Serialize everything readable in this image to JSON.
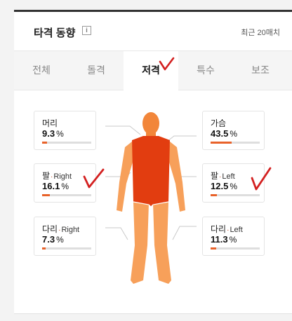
{
  "header": {
    "title": "타격 동향",
    "info_icon": "i",
    "recent_label": "최근 20매치"
  },
  "tabs": [
    {
      "label": "전체",
      "active": false
    },
    {
      "label": "돌격",
      "active": false
    },
    {
      "label": "저격",
      "active": true
    },
    {
      "label": "특수",
      "active": false
    },
    {
      "label": "보조",
      "active": false
    }
  ],
  "stats": {
    "head": {
      "label": "머리",
      "value": "9.3",
      "unit": "%",
      "fraction": 0.093
    },
    "chest": {
      "label": "가슴",
      "value": "43.5",
      "unit": "%",
      "fraction": 0.435
    },
    "arm_right": {
      "label": "팔",
      "side": "Right",
      "value": "16.1",
      "unit": "%",
      "fraction": 0.161
    },
    "arm_left": {
      "label": "팔",
      "side": "Left",
      "value": "12.5",
      "unit": "%",
      "fraction": 0.125
    },
    "leg_right": {
      "label": "다리",
      "side": "Right",
      "value": "7.3",
      "unit": "%",
      "fraction": 0.073
    },
    "leg_left": {
      "label": "다리",
      "side": "Left",
      "value": "11.3",
      "unit": "%",
      "fraction": 0.113
    }
  },
  "colors": {
    "accent": "#e8622a",
    "chest_fill": "#e23d10",
    "body_fill": "#f2863a",
    "limb_light": "#f7a05a",
    "annotation": "#d32020"
  }
}
